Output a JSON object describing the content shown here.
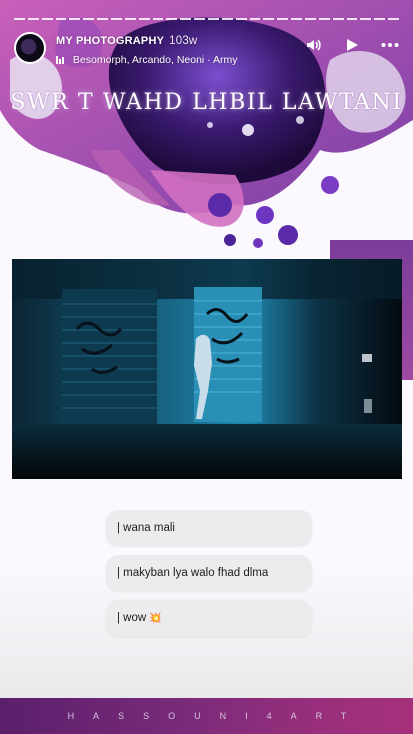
{
  "story": {
    "account_name": "MY PHOTOGRAPHY",
    "time_ago": "103w",
    "music_label": "Besomorph, Arcando, Neoni · Army",
    "progress_segments": 28,
    "title_text": "SWR T WAHD LHBIL LAWTANI",
    "replies": [
      "| wana mali",
      "| makyban lya walo fhad dlma",
      "| wow"
    ],
    "reply_emoji": "💥",
    "footer_text": "HASSOUNI4ART",
    "colors": {
      "accent": "#8a3aa0",
      "footer": "#7a2b7a",
      "video_teal": "#1a8fb4"
    }
  },
  "icons": {
    "volume": "volume-icon",
    "play": "play-icon",
    "more": "more-options-icon",
    "music": "music-bars-icon"
  }
}
